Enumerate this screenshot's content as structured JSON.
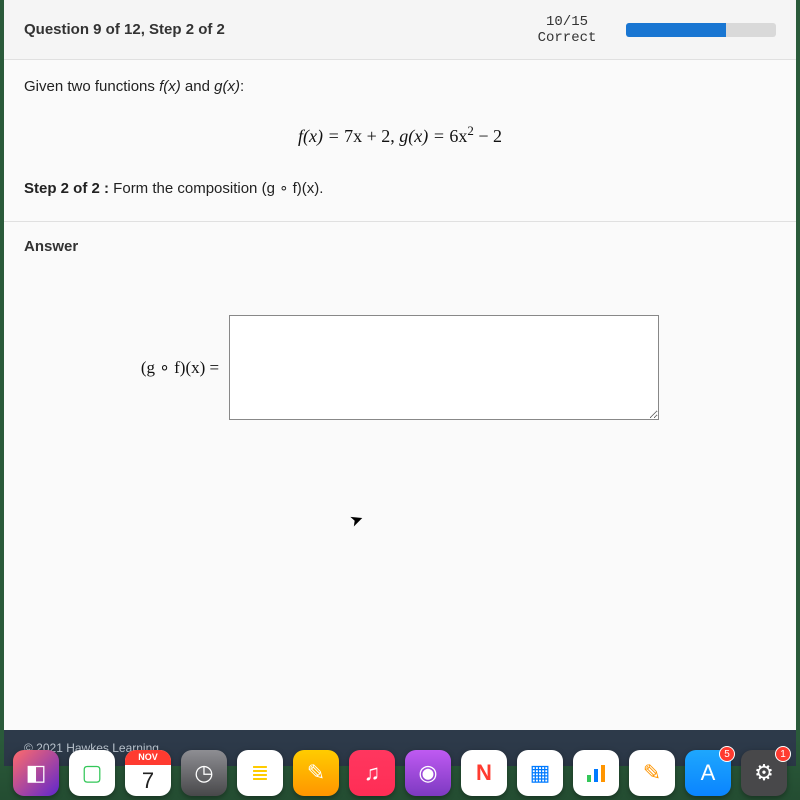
{
  "header": {
    "question_label": "Question 9 of 12, Step 2 of 2",
    "score_num": "10/15",
    "score_text": "Correct",
    "progress_percent": 66.6
  },
  "problem": {
    "given_text_pre": "Given two functions ",
    "given_text_mid": " and ",
    "given_text_post": ":",
    "fx_name": "f(x)",
    "gx_name": "g(x)",
    "equation_f_lhs": "f(x) = ",
    "equation_f_rhs": "7x + 2",
    "equation_sep": ",  ",
    "equation_g_lhs": "g(x) = ",
    "equation_g_rhs_base": "6x",
    "equation_g_rhs_exp": "2",
    "equation_g_rhs_tail": " − 2",
    "step_bold": "Step 2 of 2 :",
    "step_text": "  Form the composition (g ∘ f)(x)."
  },
  "answer": {
    "section_title": "Answer",
    "prefix": "(g ∘ f)(x) = ",
    "input_value": "",
    "input_placeholder": ""
  },
  "footer": {
    "copyright": "© 2021 Hawkes Learning"
  },
  "dock": {
    "calendar_month": "NOV",
    "calendar_day": "7",
    "appstore_badge": "5",
    "settings_badge": "1"
  }
}
